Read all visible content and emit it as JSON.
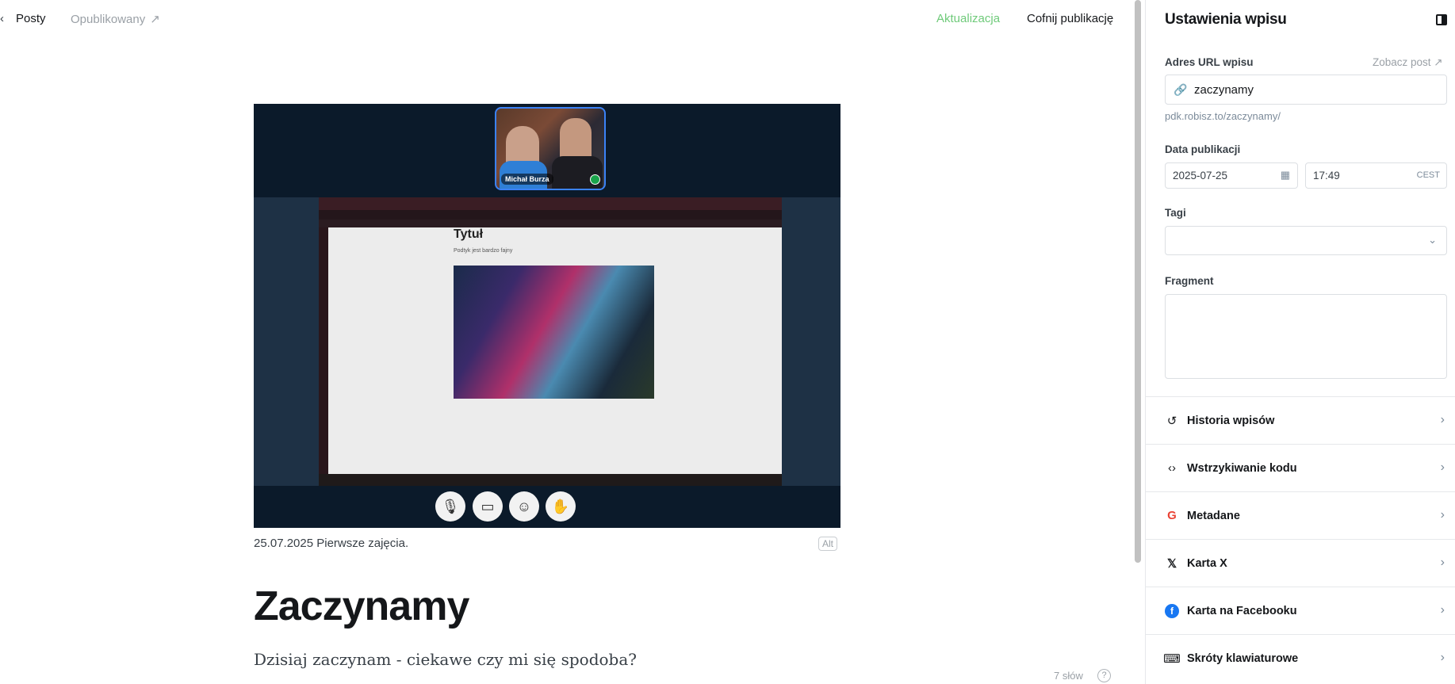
{
  "header": {
    "back_glyph": "‹",
    "breadcrumb_posts": "Posty",
    "status": "Opublikowany",
    "status_arrow": "↗",
    "update_label": "Aktualizacja",
    "unpublish_label": "Cofnij publikację"
  },
  "feature": {
    "participant_name": "Michał Burza",
    "shared_title": "Tytuł",
    "shared_subtitle": "Podtyk jest bardzo fajny",
    "controls": [
      "mic-muted-icon",
      "camera-off-icon",
      "emoji-icon",
      "raise-hand-icon"
    ],
    "caption": "25.07.2025 Pierwsze zajęcia.",
    "alt_label": "Alt"
  },
  "post": {
    "title": "Zaczynamy",
    "excerpt": "Dzisiaj zaczynam - ciekawe czy mi się spodoba?",
    "word_count": "7 słów",
    "help_glyph": "?"
  },
  "settings": {
    "title": "Ustawienia wpisu",
    "url_label": "Adres URL wpisu",
    "view_post": "Zobacz post ↗",
    "slug": "zaczynamy",
    "full_url": "pdk.robisz.to/zaczynamy/",
    "date_label": "Data publikacji",
    "date": "2025-07-25",
    "time": "17:49",
    "timezone": "CEST",
    "tags_label": "Tagi",
    "tags_value": "",
    "fragment_label": "Fragment",
    "fragment_value": "",
    "rows": [
      {
        "label": "Historia wpisów",
        "icon": "history-icon"
      },
      {
        "label": "Wstrzykiwanie kodu",
        "icon": "code-icon"
      },
      {
        "label": "Metadane",
        "icon": "google-icon"
      },
      {
        "label": "Karta X",
        "icon": "x-logo-icon"
      },
      {
        "label": "Karta na Facebooku",
        "icon": "facebook-icon"
      },
      {
        "label": "Skróty klawiaturowe",
        "icon": "keyboard-icon"
      }
    ]
  },
  "colors": {
    "accent_green": "#6fca7a",
    "facebook_blue": "#1877f2",
    "meeting_bg": "#0b1a2a"
  }
}
